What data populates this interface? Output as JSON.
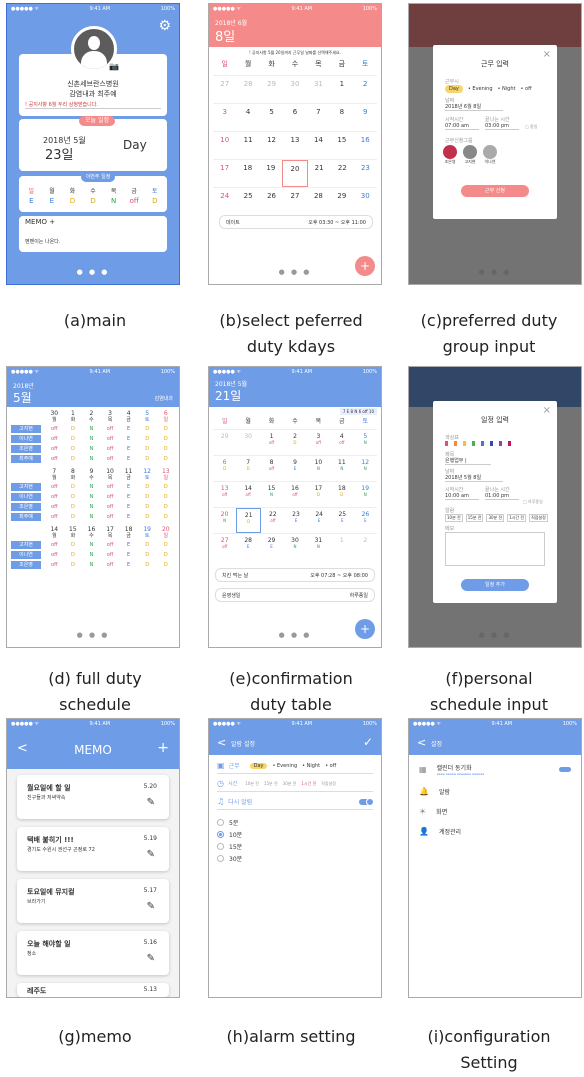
{
  "captions": {
    "a": [
      "(a)main"
    ],
    "b": [
      "(b)select peferred",
      "duty kdays"
    ],
    "c": [
      "(c)preferred duty",
      "group input"
    ],
    "d": [
      "(d) full duty",
      "schedule"
    ],
    "e": [
      "(e)confirmation",
      "duty table"
    ],
    "f": [
      "(f)personal",
      "schedule input"
    ],
    "g": [
      "(g)memo"
    ],
    "h": [
      "(h)alarm setting"
    ],
    "i": [
      "(i)configuration",
      "Setting"
    ]
  },
  "status": {
    "signal": "●●●●● ᯤ",
    "time": "9:41 AM",
    "battery": "100%"
  },
  "main": {
    "hospital": "신촌세브란스병원",
    "ward": "감염내과  최주예",
    "notice": "! 공지사항  6월 두리 상청받습니다.",
    "today_label": "오늘 일정",
    "date_year": "2018년 5월",
    "date_day": "23일",
    "shift": "Day",
    "week_label": "이번주 일정",
    "week_days": [
      "일",
      "월",
      "화",
      "수",
      "목",
      "금",
      "토"
    ],
    "week_duty": [
      "E",
      "E",
      "D",
      "D",
      "N",
      "off",
      "D"
    ],
    "memo_title": "MEMO",
    "memo_plus": "+",
    "memo_text": "멘멘이는 나온다."
  },
  "pref": {
    "year_month": "2018년 6월",
    "day": "8일",
    "notice": "! 공지사항  5월 20일까지 근무일 날짜를 선택해주세요.",
    "weekdays": [
      "일",
      "월",
      "화",
      "수",
      "목",
      "금",
      "토"
    ],
    "rows": [
      [
        "27",
        "28",
        "29",
        "30",
        "31",
        "1",
        "2"
      ],
      [
        "3",
        "4",
        "5",
        "6",
        "7",
        "8",
        "9"
      ],
      [
        "10",
        "11",
        "12",
        "13",
        "14",
        "15",
        "16"
      ],
      [
        "17",
        "18",
        "19",
        "20",
        "21",
        "22",
        "23"
      ],
      [
        "24",
        "25",
        "26",
        "27",
        "28",
        "29",
        "30"
      ]
    ],
    "event": "데이트",
    "event_time": "오후 03:30 ~ 오후 11:00",
    "fab": "+"
  },
  "group": {
    "title": "근무 입력",
    "close": "×",
    "duty_label": "근무시",
    "duty_opts": [
      "Day",
      "Evening",
      "Night",
      "off"
    ],
    "date_label": "날짜",
    "date": "2018년 6월 8일",
    "start_label": "시작시간",
    "end_label": "끝나는 시간",
    "start": "07:00 am",
    "end": "03:00 pm",
    "allday": "□ 종일",
    "group_label": "근무신청그룹",
    "members": [
      "조은영",
      "고지현",
      "이나연"
    ],
    "submit": "근무 신청"
  },
  "full": {
    "year": "2018년",
    "month": "5월",
    "dept": "감염내과",
    "names": [
      "고지현",
      "이나연",
      "조은영",
      "최주예"
    ],
    "weeks": [
      {
        "dates": [
          "30",
          "1",
          "2",
          "3",
          "4",
          "5",
          "6"
        ],
        "days": [
          "월",
          "화",
          "수",
          "목",
          "금",
          "토",
          "일"
        ],
        "duty": [
          [
            "off",
            "D",
            "N",
            "off",
            "E",
            "D",
            "D"
          ],
          [
            "off",
            "D",
            "N",
            "off",
            "E",
            "D",
            "D"
          ],
          [
            "off",
            "D",
            "N",
            "off",
            "E",
            "D",
            "D"
          ],
          [
            "off",
            "D",
            "N",
            "off",
            "E",
            "D",
            "D"
          ]
        ]
      },
      {
        "dates": [
          "7",
          "8",
          "9",
          "10",
          "11",
          "12",
          "13"
        ],
        "days": [
          "월",
          "화",
          "수",
          "목",
          "금",
          "토",
          "일"
        ],
        "duty": [
          [
            "off",
            "D",
            "N",
            "off",
            "E",
            "D",
            "D"
          ],
          [
            "off",
            "D",
            "N",
            "off",
            "E",
            "D",
            "D"
          ],
          [
            "off",
            "D",
            "N",
            "off",
            "E",
            "D",
            "D"
          ],
          [
            "off",
            "D",
            "N",
            "off",
            "E",
            "D",
            "D"
          ]
        ]
      },
      {
        "dates": [
          "14",
          "15",
          "16",
          "17",
          "18",
          "19",
          "20"
        ],
        "days": [
          "월",
          "화",
          "수",
          "목",
          "금",
          "토",
          "일"
        ],
        "duty": [
          [
            "off",
            "D",
            "N",
            "off",
            "E",
            "D",
            "D"
          ],
          [
            "off",
            "D",
            "N",
            "off",
            "E",
            "D",
            "D"
          ],
          [
            "off",
            "D",
            "N",
            "off",
            "E",
            "D",
            "D"
          ]
        ]
      }
    ]
  },
  "confirm": {
    "year_month": "2018년 5월",
    "day": "21일",
    "legend": "7  E 8  N 6  off 10",
    "weekdays": [
      "일",
      "월",
      "화",
      "수",
      "목",
      "금",
      "토"
    ],
    "rows": [
      {
        "d": [
          "29",
          "30",
          "1",
          "2",
          "3",
          "4",
          "5"
        ],
        "s": [
          "",
          "",
          "off",
          "D",
          "off",
          "off",
          "N"
        ]
      },
      {
        "d": [
          "6",
          "7",
          "8",
          "9",
          "10",
          "11",
          "12"
        ],
        "s": [
          "D",
          "D",
          "off",
          "E",
          "N",
          "N",
          "N"
        ]
      },
      {
        "d": [
          "13",
          "14",
          "15",
          "16",
          "17",
          "18",
          "19"
        ],
        "s": [
          "off",
          "off",
          "N",
          "off",
          "D",
          "D",
          "N"
        ]
      },
      {
        "d": [
          "20",
          "21",
          "22",
          "23",
          "24",
          "25",
          "26"
        ],
        "s": [
          "N",
          "D",
          "off",
          "E",
          "E",
          "E",
          "E"
        ]
      },
      {
        "d": [
          "27",
          "28",
          "29",
          "30",
          "31",
          "1",
          "2"
        ],
        "s": [
          "off",
          "E",
          "E",
          "N",
          "N",
          "",
          ""
        ]
      }
    ],
    "events": [
      {
        "title": "치킨 먹는 날",
        "time": "오후 07:28 ~ 오후 08:00"
      },
      {
        "title": "윤영생일",
        "time": "하루종일"
      }
    ],
    "fab": "+"
  },
  "personal": {
    "title": "일정 입력",
    "close": "×",
    "color_label": "색상표",
    "title_label": "제목",
    "title_value": "은행업무 |",
    "date_label": "날짜",
    "date": "2018년 5월 8일",
    "start_label": "시작시간",
    "end_label": "끝나는 시간",
    "start": "10:00 am",
    "end": "01:00 pm",
    "allday": "□ 하루종일",
    "alarm_label": "알람",
    "alarm_opts": [
      "10분 전",
      "15분 전",
      "30분 전",
      "1시간 전",
      "직접설정"
    ],
    "memo_label": "메모",
    "submit": "일정 추가"
  },
  "memo": {
    "back": "<",
    "title": "MEMO",
    "add": "+",
    "items": [
      {
        "title": "월요일에 할 일",
        "sub": "친구들과 저녁약속",
        "date": "5.20"
      },
      {
        "title": "택배 붙히기 !!!",
        "sub": "경기도 수원시 권선구 곤정로 72",
        "date": "5.19"
      },
      {
        "title": "토요일에 뮤지컬",
        "sub": "브라가기",
        "date": "5.17"
      },
      {
        "title": "오늘 해야할 일",
        "sub": "청소",
        "date": "5.16"
      },
      {
        "title": "레주도",
        "sub": "",
        "date": "5.13"
      }
    ]
  },
  "alarm": {
    "back": "<",
    "title": "알람 설정",
    "check": "✓",
    "duty_label": "근무",
    "duty_opts": [
      "Day",
      "Evening",
      "Night",
      "off"
    ],
    "time_label": "시간",
    "time_opts": [
      "10분 전",
      "15분 전",
      "30분 전",
      "1시간 전",
      "직접설정"
    ],
    "repeat_label": "다시 알림",
    "options": [
      "5분",
      "10분",
      "15분",
      "30분"
    ],
    "selected": 1
  },
  "config": {
    "back": "<",
    "title": "설정",
    "items": [
      {
        "label": "캘린더 동기화",
        "sub": "▪▪▪▪ ▪▪▪▪▪ ▪▪▪▪▪▪▪ ▪▪▪▪▪▪",
        "toggle": true
      },
      {
        "label": "알람",
        "toggle": false
      },
      {
        "label": "화면",
        "toggle": false
      },
      {
        "label": "계정관리",
        "toggle": false
      }
    ]
  },
  "colors": {
    "blue": "#6f9ce6",
    "red": "#f58a8a",
    "dark": "#6a6a6a"
  }
}
